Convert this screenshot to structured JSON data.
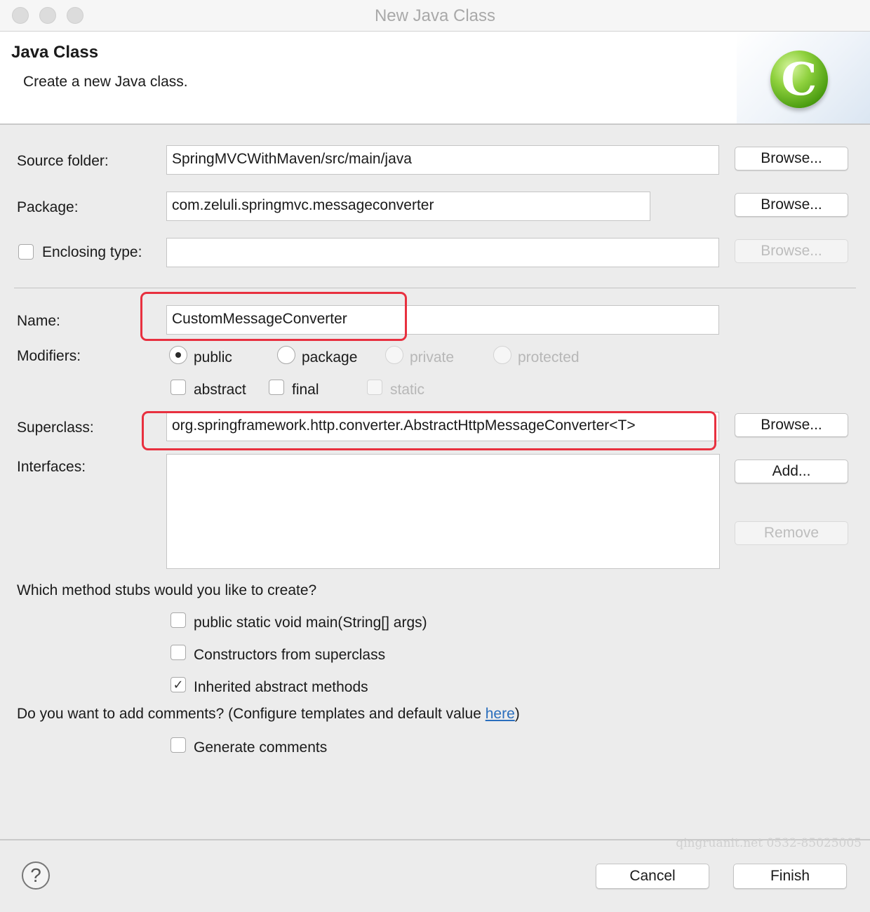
{
  "window": {
    "title": "New Java Class"
  },
  "banner": {
    "title": "Java Class",
    "subtitle": "Create a new Java class.",
    "logo_glyph": "C"
  },
  "form": {
    "source_folder": {
      "label": "Source folder:",
      "value": "SpringMVCWithMaven/src/main/java",
      "browse": "Browse..."
    },
    "package": {
      "label": "Package:",
      "value": "com.zeluli.springmvc.messageconverter",
      "browse": "Browse..."
    },
    "enclosing_type": {
      "label": "Enclosing type:",
      "value": "",
      "checked": false,
      "browse": "Browse..."
    },
    "name": {
      "label": "Name:",
      "value": "CustomMessageConverter"
    },
    "modifiers": {
      "label": "Modifiers:",
      "options": [
        {
          "label": "public",
          "selected": true,
          "enabled": true
        },
        {
          "label": "package",
          "selected": false,
          "enabled": true
        },
        {
          "label": "private",
          "selected": false,
          "enabled": false
        },
        {
          "label": "protected",
          "selected": false,
          "enabled": false
        }
      ],
      "flags": [
        {
          "label": "abstract",
          "checked": false,
          "enabled": true
        },
        {
          "label": "final",
          "checked": false,
          "enabled": true
        },
        {
          "label": "static",
          "checked": false,
          "enabled": false
        }
      ]
    },
    "superclass": {
      "label": "Superclass:",
      "value": "org.springframework.http.converter.AbstractHttpMessageConverter<T>",
      "browse": "Browse..."
    },
    "interfaces": {
      "label": "Interfaces:",
      "add": "Add...",
      "remove": "Remove"
    }
  },
  "stubs": {
    "question": "Which method stubs would you like to create?",
    "options": [
      {
        "label": "public static void main(String[] args)",
        "checked": false
      },
      {
        "label": "Constructors from superclass",
        "checked": false
      },
      {
        "label": "Inherited abstract methods",
        "checked": true
      }
    ]
  },
  "comments": {
    "question_prefix": "Do you want to add comments? (Configure templates and default value ",
    "link": "here",
    "question_suffix": ")",
    "generate": {
      "label": "Generate comments",
      "checked": false
    }
  },
  "footer": {
    "help": "?",
    "cancel": "Cancel",
    "finish": "Finish",
    "watermark": "qingruanit.net 0532-85025005"
  },
  "colors": {
    "highlight": "#e8303f",
    "link": "#2a6ebd",
    "logo": "#6bbf1f"
  }
}
